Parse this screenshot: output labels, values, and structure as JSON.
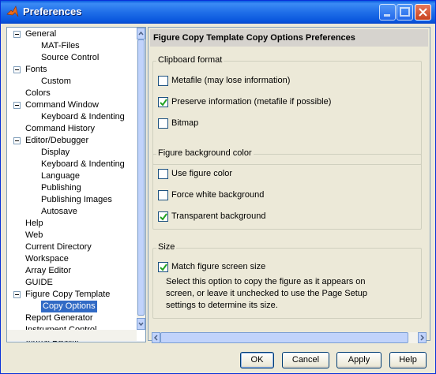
{
  "window": {
    "title": "Preferences"
  },
  "tree": {
    "items": [
      {
        "label": "General",
        "level": 0,
        "expanded": true
      },
      {
        "label": "MAT-Files",
        "level": 1
      },
      {
        "label": "Source Control",
        "level": 1
      },
      {
        "label": "Fonts",
        "level": 0,
        "expanded": true
      },
      {
        "label": "Custom",
        "level": 1
      },
      {
        "label": "Colors",
        "level": 0
      },
      {
        "label": "Command Window",
        "level": 0,
        "expanded": true
      },
      {
        "label": "Keyboard & Indenting",
        "level": 1
      },
      {
        "label": "Command History",
        "level": 0
      },
      {
        "label": "Editor/Debugger",
        "level": 0,
        "expanded": true
      },
      {
        "label": "Display",
        "level": 1
      },
      {
        "label": "Keyboard & Indenting",
        "level": 1
      },
      {
        "label": "Language",
        "level": 1
      },
      {
        "label": "Publishing",
        "level": 1
      },
      {
        "label": "Publishing Images",
        "level": 1
      },
      {
        "label": "Autosave",
        "level": 1
      },
      {
        "label": "Help",
        "level": 0
      },
      {
        "label": "Web",
        "level": 0
      },
      {
        "label": "Current Directory",
        "level": 0
      },
      {
        "label": "Workspace",
        "level": 0
      },
      {
        "label": "Array Editor",
        "level": 0
      },
      {
        "label": "GUIDE",
        "level": 0
      },
      {
        "label": "Figure Copy Template",
        "level": 0,
        "expanded": true
      },
      {
        "label": "Copy Options",
        "level": 1,
        "selected": true
      },
      {
        "label": "Report Generator",
        "level": 0
      },
      {
        "label": "Instrument Control",
        "level": 0
      },
      {
        "label": "Virtual Reality",
        "level": 0
      }
    ]
  },
  "panel": {
    "header": "Figure Copy Template Copy Options Preferences",
    "clipboard": {
      "title": "Clipboard format",
      "options": [
        {
          "label": "Metafile (may lose information)",
          "checked": false
        },
        {
          "label": "Preserve information (metafile if possible)",
          "checked": true
        },
        {
          "label": "Bitmap",
          "checked": false
        }
      ]
    },
    "background": {
      "title": "Figure background color",
      "options": [
        {
          "label": "Use figure color",
          "checked": false
        },
        {
          "label": "Force white background",
          "checked": false
        },
        {
          "label": "Transparent background",
          "checked": true
        }
      ]
    },
    "size": {
      "title": "Size",
      "option": {
        "label": "Match figure screen size",
        "checked": true
      },
      "description": "Select this option to copy the figure as it appears on screen, or leave it unchecked to use the Page Setup settings to determine its size."
    }
  },
  "buttons": {
    "ok": "OK",
    "cancel": "Cancel",
    "apply": "Apply",
    "help": "Help"
  },
  "colors": {
    "titlebar": "#0a5ce0",
    "selection": "#316ac5",
    "check": "#21a121"
  }
}
